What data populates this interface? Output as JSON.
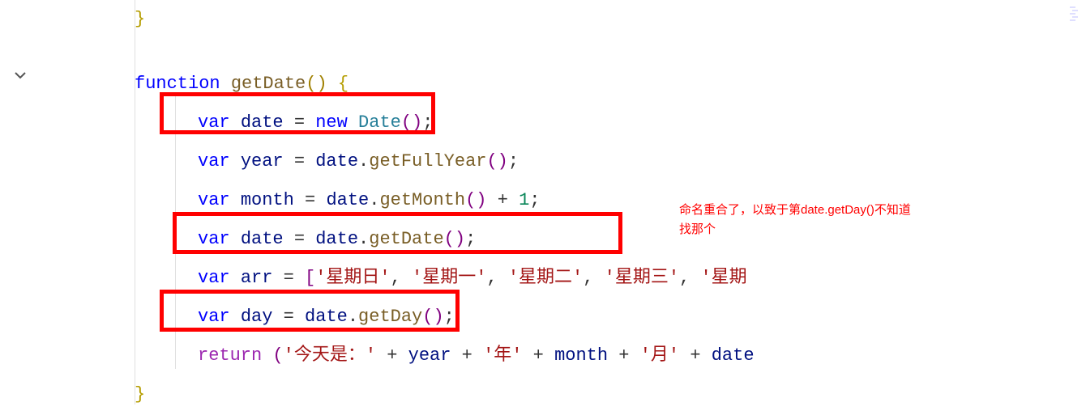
{
  "code": {
    "line0": "}",
    "line2_function": "function",
    "line2_name": "getDate",
    "line2_parens": "()",
    "line2_brace": "{",
    "line3_var": "var",
    "line3_ident": "date",
    "line3_eq": "=",
    "line3_new": "new",
    "line3_cls": "Date",
    "line3_parens": "()",
    "line3_semi": ";",
    "line4_var": "var",
    "line4_ident": "year",
    "line4_eq": "=",
    "line4_obj": "date",
    "line4_method": "getFullYear",
    "line4_parens": "()",
    "line4_semi": ";",
    "line5_var": "var",
    "line5_ident": "month",
    "line5_eq": "=",
    "line5_obj": "date",
    "line5_method": "getMonth",
    "line5_parens": "()",
    "line5_plus": "+",
    "line5_num": "1",
    "line5_semi": ";",
    "line6_var": "var",
    "line6_ident": "date",
    "line6_eq": "=",
    "line6_obj": "date",
    "line6_method": "getDate",
    "line6_parens": "()",
    "line6_semi": ";",
    "line7_var": "var",
    "line7_ident": "arr",
    "line7_eq": "=",
    "line7_bracket": "[",
    "line7_s0": "'星期日'",
    "line7_s1": "'星期一'",
    "line7_s2": "'星期二'",
    "line7_s3": "'星期三'",
    "line7_s4": "'星期",
    "line7_comma": ", ",
    "line8_var": "var",
    "line8_ident": "day",
    "line8_eq": "=",
    "line8_obj": "date",
    "line8_method": "getDay",
    "line8_parens": "()",
    "line8_semi": ";",
    "line9_return": "return",
    "line9_paren_open": "(",
    "line9_str0": "'今天是：'",
    "line9_plus": "+",
    "line9_year": "year",
    "line9_str1": "'年'",
    "line9_month": "month",
    "line9_str2": "'月'",
    "line9_date": "date",
    "line10_brace": "}"
  },
  "annotation": {
    "line1": "命名重合了，以致于第date.getDay()不知道",
    "line2": "找那个"
  },
  "icons": {
    "fold": "chevron-down-icon"
  }
}
